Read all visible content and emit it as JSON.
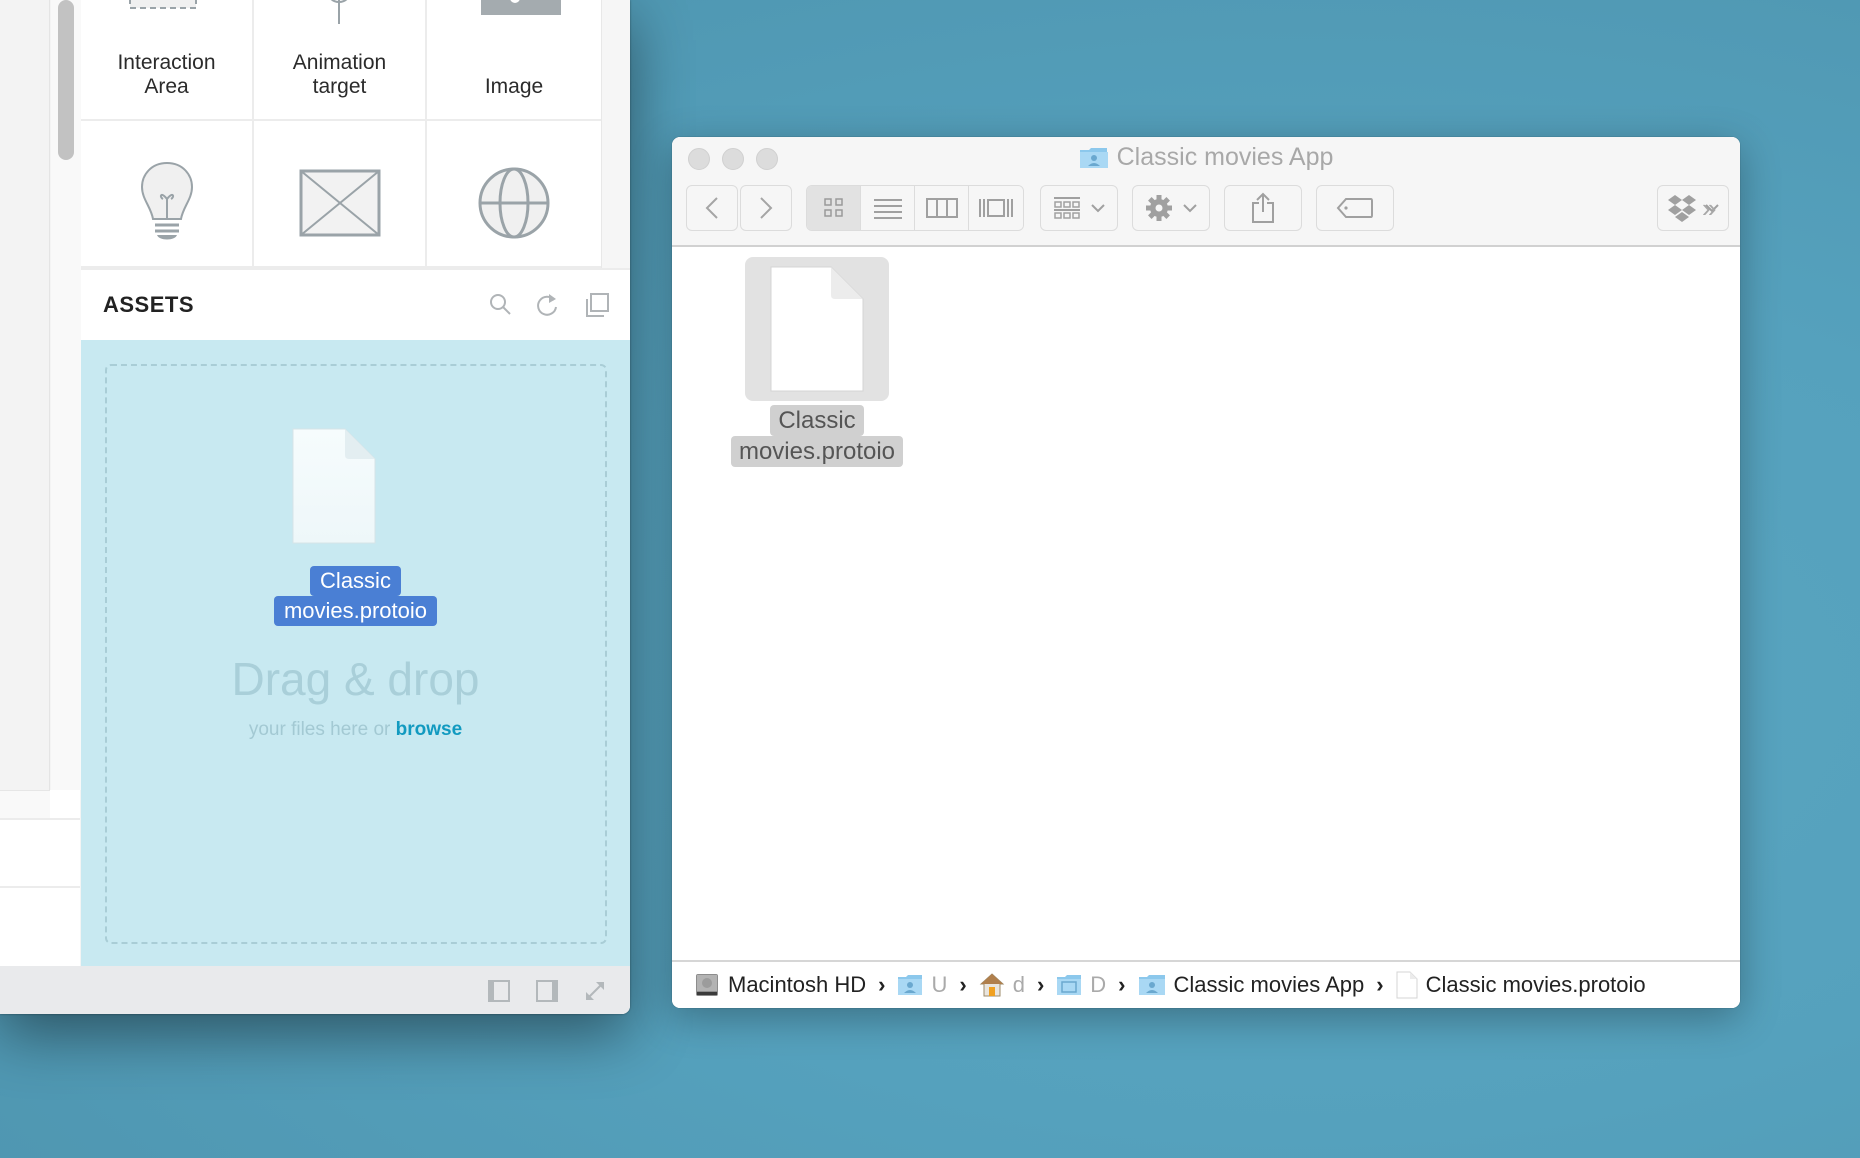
{
  "left_panel": {
    "widgets": [
      {
        "label_line1": "Interaction",
        "label_line2": "Area",
        "icon": "interaction-area-icon"
      },
      {
        "label_line1": "Animation",
        "label_line2": "target",
        "icon": "animation-target-icon"
      },
      {
        "label_line1": "",
        "label_line2": "Image",
        "icon": "image-icon"
      },
      {
        "label_line1": "",
        "label_line2": "",
        "icon": "lightbulb-icon"
      },
      {
        "label_line1": "",
        "label_line2": "",
        "icon": "placeholder-box-icon"
      },
      {
        "label_line1": "",
        "label_line2": "",
        "icon": "globe-icon"
      }
    ],
    "assets": {
      "title": "ASSETS",
      "icons": [
        "search-icon",
        "refresh-icon",
        "new-window-icon"
      ]
    },
    "drop_zone": {
      "dragged_file_line1": "Classic",
      "dragged_file_line2": "movies.protoio",
      "title": "Drag & drop",
      "subtitle": "your files here or",
      "browse_link": "browse"
    },
    "bottom_bar_icons": [
      "left-panel-toggle-icon",
      "right-panel-toggle-icon",
      "expand-icon"
    ]
  },
  "finder": {
    "title": "Classic movies App",
    "toolbar": {
      "back": "back-icon",
      "forward": "forward-icon",
      "views": [
        "icon-view",
        "list-view",
        "column-view",
        "cover-flow-view"
      ],
      "active_view": "icon-view",
      "arrange": "arrange-icon",
      "action": "gear-icon",
      "share": "share-icon",
      "tags": "tag-icon",
      "dropbox": "dropbox-icon",
      "overflow": "»"
    },
    "items": [
      {
        "name_line1": "Classic",
        "name_line2": "movies.protoio",
        "selected": true
      }
    ],
    "path": [
      {
        "label": "Macintosh HD",
        "icon": "hard-drive-icon",
        "faded": false
      },
      {
        "label": "U",
        "icon": "users-folder-icon",
        "faded": true
      },
      {
        "label": "d",
        "icon": "home-icon",
        "faded": true
      },
      {
        "label": "D",
        "icon": "documents-folder-icon",
        "faded": true
      },
      {
        "label": "Classic movies App",
        "icon": "folder-icon",
        "faded": false
      },
      {
        "label": "Classic movies.protoio",
        "icon": "document-icon",
        "faded": false
      }
    ]
  }
}
